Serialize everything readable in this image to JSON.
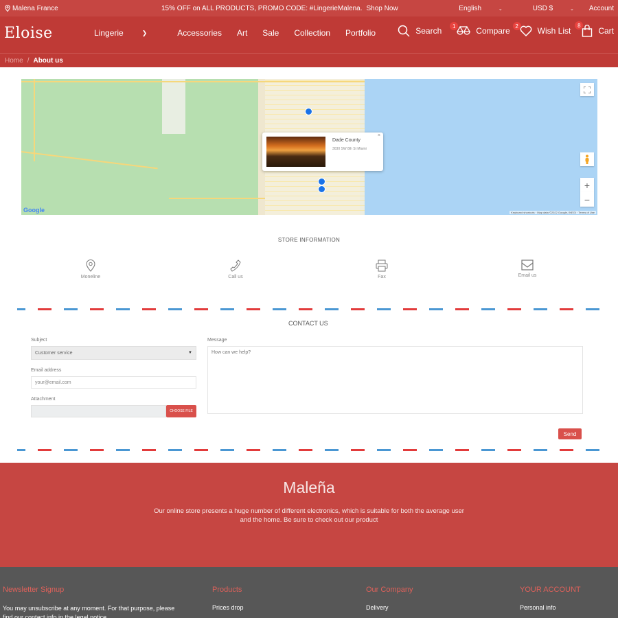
{
  "topbar": {
    "location": "Malena France",
    "promo": "15% OFF on ALL PRODUCTS, PROMO CODE: #LingerieMalena.",
    "shop_now": "Shop Now",
    "language": "English",
    "currency": "USD $",
    "account": "Account"
  },
  "header": {
    "logo": "Eloise",
    "nav": [
      "Lingerie",
      "Accessories",
      "Art",
      "Sale",
      "Collection",
      "Portfolio"
    ],
    "search": "Search",
    "compare": "Compare",
    "compare_count": "1",
    "wishlist": "Wish List",
    "wishlist_count": "2",
    "cart": "Cart",
    "cart_count": "8"
  },
  "breadcrumb": {
    "home": "Home",
    "separator": "/",
    "current": "About us"
  },
  "map": {
    "popup_title": "Dade County",
    "popup_address": "3030 SW 8th St Miami",
    "popup_close": "×",
    "zoom_in": "+",
    "zoom_out": "−",
    "logo": "Google",
    "attribution": "Keyboard shortcuts · Map data ©2022 Google, INEGI · Terms of Use"
  },
  "store_info": {
    "title": "STORE INFORMATION",
    "items": [
      {
        "icon": "map-pin-icon",
        "label": "Moneline"
      },
      {
        "icon": "phone-icon",
        "label": "Call us"
      },
      {
        "icon": "printer-icon",
        "label": "Fax"
      },
      {
        "icon": "envelope-icon",
        "label": "Email us"
      }
    ]
  },
  "contact": {
    "title": "CONTACT US",
    "subject_label": "Subject",
    "subject_value": "Customer service",
    "email_label": "Email address",
    "email_placeholder": "your@email.com",
    "attachment_label": "Attachment",
    "choose_file": "CHOOSE FILE",
    "message_label": "Message",
    "message_placeholder": "How can we help?",
    "send": "Send"
  },
  "about": {
    "brand": "Maleña",
    "description": "Our online store presents a huge number of different electronics, which is suitable for both the average user and the home. Be sure to check out our product"
  },
  "footer": {
    "newsletter_title": "Newsletter Signup",
    "newsletter_text": "You may unsubscribe at any moment. For that purpose, please find our contact info in the legal notice.",
    "products_title": "Products",
    "products_links": [
      "Prices drop"
    ],
    "company_title": "Our Company",
    "company_links": [
      "Delivery"
    ],
    "account_title": "YOUR ACCOUNT",
    "account_links": [
      "Personal info"
    ]
  },
  "colors": {
    "brand_red": "#bf3a36",
    "topbar_red": "#c64642",
    "button_red": "#d9504b",
    "footer_gray": "#575757",
    "footer_heading": "#e0615a",
    "dash_blue": "#4a97d3",
    "dash_red": "#e23b3b"
  }
}
